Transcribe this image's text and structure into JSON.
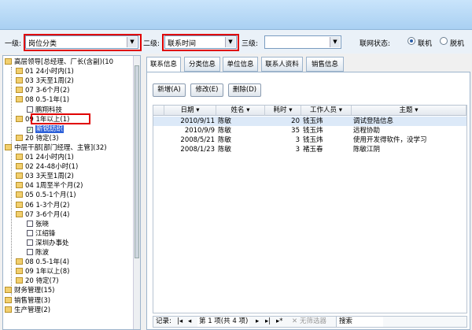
{
  "filters": {
    "level1_label": "一级:",
    "level1_value": "岗位分类",
    "level2_label": "二级:",
    "level2_value": "联系时间",
    "level3_label": "三级:",
    "level3_value": "",
    "network_label": "联网状态:",
    "online_label": "联机",
    "offline_label": "脱机",
    "network_selected": "online"
  },
  "tree": {
    "items": [
      {
        "label": "高层领导[总经理、厂长(含副)(10",
        "type": "folder",
        "indent": 0
      },
      {
        "label": "01 24小时内(1)",
        "type": "folder",
        "indent": 1
      },
      {
        "label": "03 3天至1周(2)",
        "type": "folder",
        "indent": 1
      },
      {
        "label": "07 3-6个月(2)",
        "type": "folder",
        "indent": 1
      },
      {
        "label": "08 0.5-1年(1)",
        "type": "folder",
        "indent": 1
      },
      {
        "label": "鹏翔科技",
        "type": "check",
        "indent": 2,
        "checked": false
      },
      {
        "label": "09 1年以上(1)",
        "type": "folder",
        "indent": 1
      },
      {
        "label": "新锐纺织",
        "type": "check",
        "indent": 2,
        "checked": true,
        "selected": true
      },
      {
        "label": "20 待定(3)",
        "type": "folder",
        "indent": 1
      },
      {
        "label": "中层干部[部门经理、主管](32)",
        "type": "folder",
        "indent": 0
      },
      {
        "label": "01 24小时内(1)",
        "type": "folder",
        "indent": 1
      },
      {
        "label": "02 24-48小时(1)",
        "type": "folder",
        "indent": 1
      },
      {
        "label": "03 3天至1周(2)",
        "type": "folder",
        "indent": 1
      },
      {
        "label": "04 1周至半个月(2)",
        "type": "folder",
        "indent": 1
      },
      {
        "label": "05 0.5-1个月(1)",
        "type": "folder",
        "indent": 1
      },
      {
        "label": "06 1-3个月(2)",
        "type": "folder",
        "indent": 1
      },
      {
        "label": "07 3-6个月(4)",
        "type": "folder",
        "indent": 1
      },
      {
        "label": "张晓",
        "type": "check",
        "indent": 2,
        "checked": false
      },
      {
        "label": "江绍锋",
        "type": "check",
        "indent": 2,
        "checked": false
      },
      {
        "label": "深圳办事处",
        "type": "check",
        "indent": 2,
        "checked": false
      },
      {
        "label": "陈波",
        "type": "check",
        "indent": 2,
        "checked": false
      },
      {
        "label": "08 0.5-1年(4)",
        "type": "folder",
        "indent": 1
      },
      {
        "label": "09 1年以上(8)",
        "type": "folder",
        "indent": 1
      },
      {
        "label": "20 待定(7)",
        "type": "folder",
        "indent": 1
      },
      {
        "label": "财务管理(15)",
        "type": "folder",
        "indent": 0
      },
      {
        "label": "销售管理(3)",
        "type": "folder",
        "indent": 0
      },
      {
        "label": "生产管理(2)",
        "type": "folder",
        "indent": 0
      }
    ]
  },
  "tabs": [
    "联系信息",
    "分类信息",
    "单位信息",
    "联系人资料",
    "销售信息"
  ],
  "buttons": {
    "add": "新增(A)",
    "edit": "修改(E)",
    "delete": "删除(D)"
  },
  "grid": {
    "columns": [
      "日期",
      "姓名",
      "耗时",
      "工作人员",
      "主题"
    ],
    "rows": [
      [
        "2010/9/11",
        "陈敏",
        "20",
        "钱玉炜",
        "调试登陆信息"
      ],
      [
        "2010/9/9",
        "陈敏",
        "35",
        "钱玉炜",
        "远程协助"
      ],
      [
        "2008/5/21",
        "陈敏",
        "3",
        "钱玉炜",
        "使用开发得软件，没学习"
      ],
      [
        "2008/1/23",
        "陈敏",
        "3",
        "褚玉春",
        "陈敏江阴"
      ]
    ]
  },
  "navigator": {
    "record_label": "记录:",
    "page_text": "第 1 项(共 4 项)",
    "filter_text": "无筛选器",
    "search_text": "搜索"
  }
}
